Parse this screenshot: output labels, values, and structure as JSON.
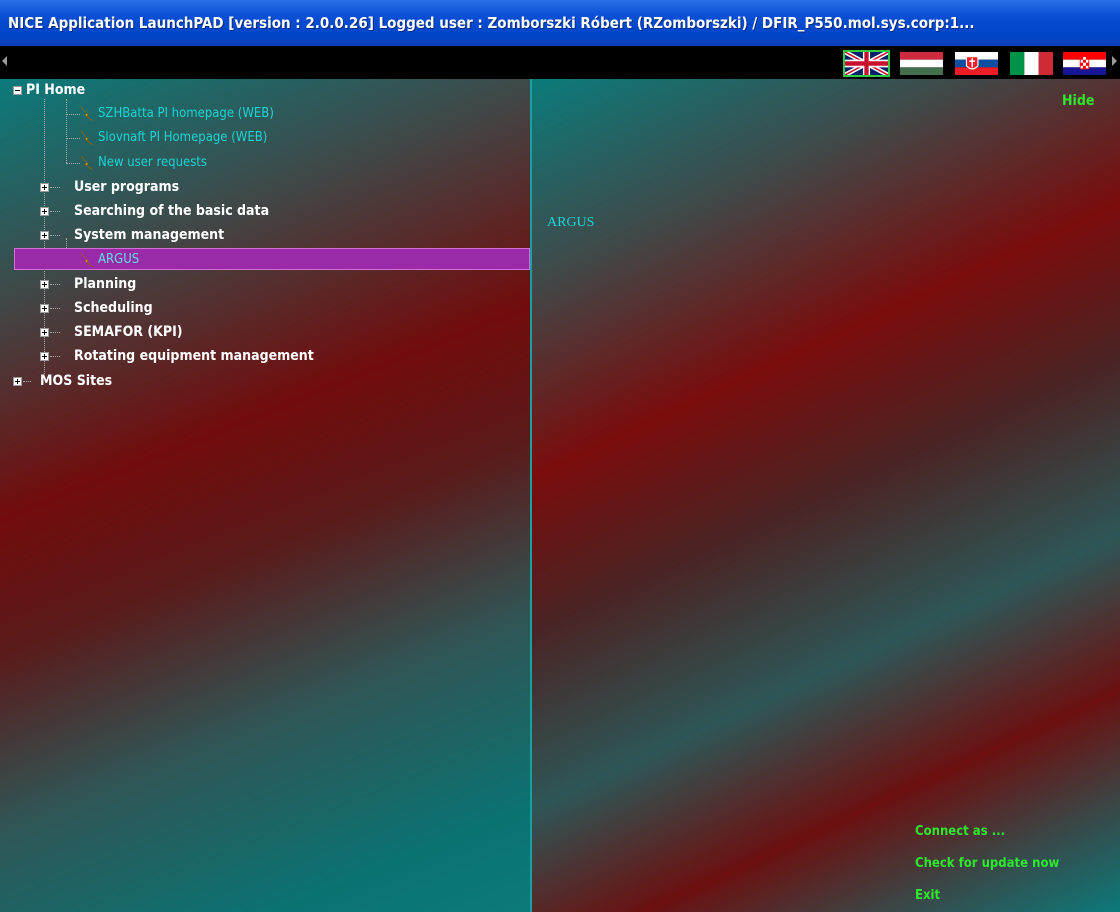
{
  "window": {
    "title": "NICE Application LaunchPAD  [version : 2.0.0.26]   Logged user : Zomborszki Róbert  (RZomborszki) / DFIR_P550.mol.sys.corp:1..."
  },
  "languages": [
    {
      "name": "English",
      "icon": "uk-flag-icon",
      "selected": true
    },
    {
      "name": "Hungarian",
      "icon": "hungary-flag-icon",
      "selected": false
    },
    {
      "name": "Slovak",
      "icon": "slovakia-flag-icon",
      "selected": false
    },
    {
      "name": "Italian",
      "icon": "italy-flag-icon",
      "selected": false
    },
    {
      "name": "Croatian",
      "icon": "croatia-flag-icon",
      "selected": false
    }
  ],
  "tree": {
    "root1": {
      "label": "PI Home",
      "expanded": true
    },
    "links_top": [
      {
        "label": "SZHBatta PI homepage (WEB)"
      },
      {
        "label": "Slovnaft PI Homepage (WEB)"
      },
      {
        "label": "New user requests"
      }
    ],
    "folders_a": [
      {
        "label": "User programs"
      },
      {
        "label": "Searching of the basic data"
      },
      {
        "label": "System management"
      }
    ],
    "selected_link": {
      "label": "ARGUS"
    },
    "folders_b": [
      {
        "label": "Planning"
      },
      {
        "label": "Scheduling"
      },
      {
        "label": "SEMAFOR (KPI)"
      },
      {
        "label": "Rotating equipment management"
      }
    ],
    "root2": {
      "label": "MOS Sites",
      "expanded": false
    }
  },
  "right_panel": {
    "hide_label": "Hide",
    "detail_title": "ARGUS",
    "connect_as": "Connect as ...",
    "check_update": "Check for update now",
    "exit": "Exit"
  },
  "colors": {
    "link_text": "#1cd4d4",
    "action_text": "#2ee82e",
    "selection": "#9b2aa8",
    "titlebar": "#0047cc"
  }
}
